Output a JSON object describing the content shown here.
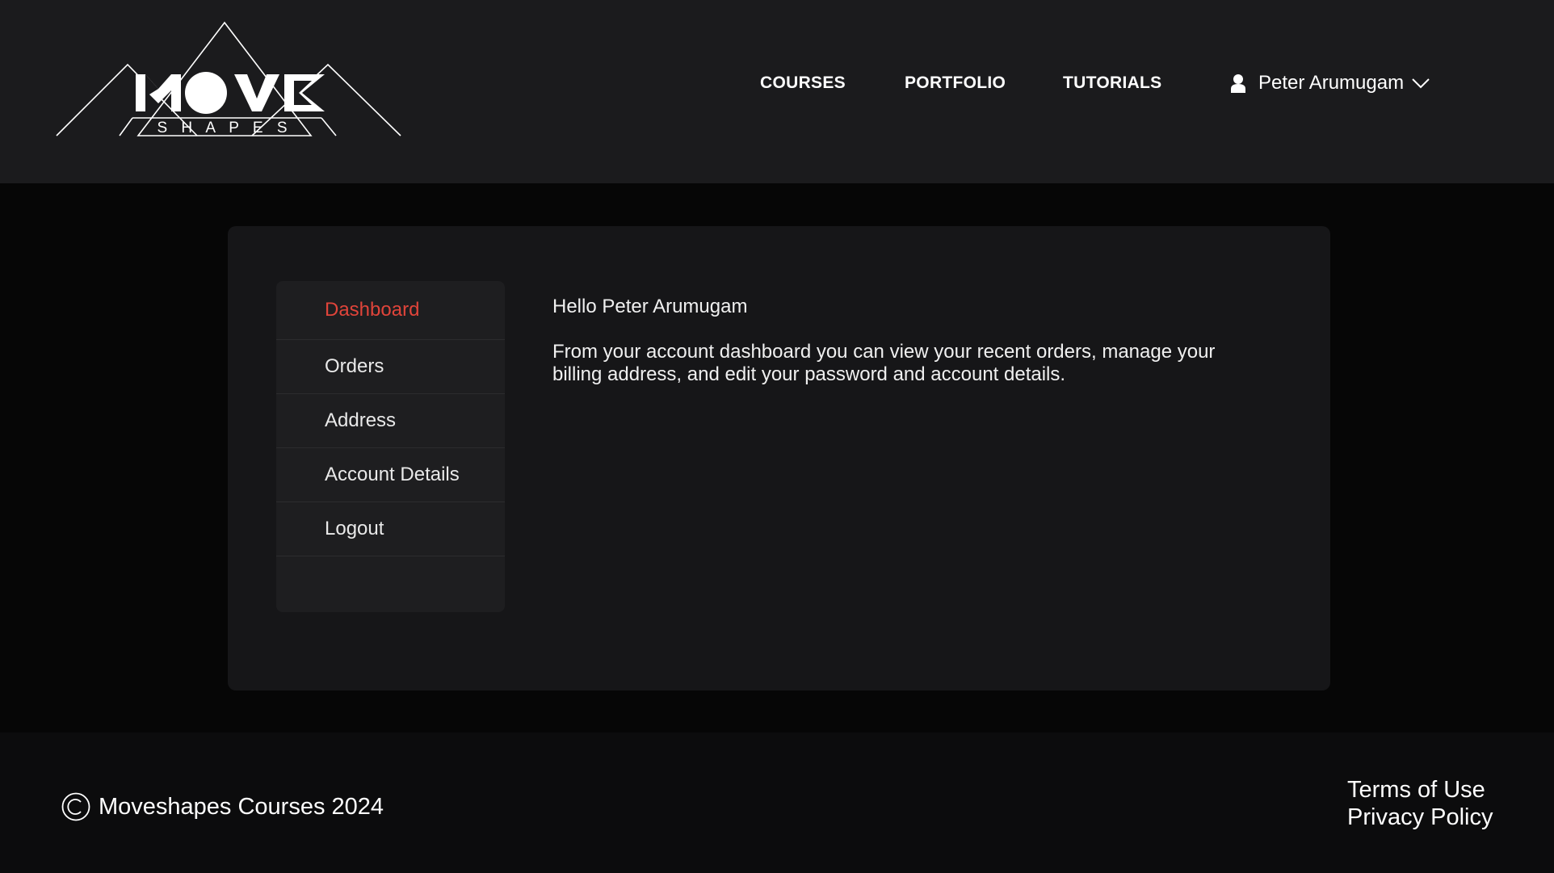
{
  "header": {
    "logo": {
      "wordmark": "MOVE",
      "tagline": "S H A P E S"
    },
    "nav": [
      {
        "label": "COURSES"
      },
      {
        "label": "PORTFOLIO"
      },
      {
        "label": "TUTORIALS"
      }
    ],
    "user": {
      "name": "Peter Arumugam",
      "icon": "user-icon",
      "dropdown_icon": "chevron-down-icon"
    }
  },
  "account": {
    "sidebar": {
      "items": [
        {
          "label": "Dashboard",
          "active": true
        },
        {
          "label": "Orders"
        },
        {
          "label": "Address"
        },
        {
          "label": "Account Details"
        },
        {
          "label": "Logout"
        }
      ]
    },
    "content": {
      "greeting": "Hello Peter Arumugam",
      "intro": "From your account dashboard you can view your recent orders, manage your billing address, and edit your password and account details."
    }
  },
  "footer": {
    "copyright_icon": "copyright-icon",
    "copyright": "Moveshapes Courses 2024",
    "links": [
      {
        "label": "Terms of Use"
      },
      {
        "label": "Privacy Policy"
      }
    ]
  },
  "colors": {
    "header_bg": "#1b1b1d",
    "page_bg": "#060606",
    "card_bg": "#161618",
    "sidebar_bg": "#1e1e20",
    "accent": "#e0443a",
    "footer_bg": "#0c0c0d"
  }
}
